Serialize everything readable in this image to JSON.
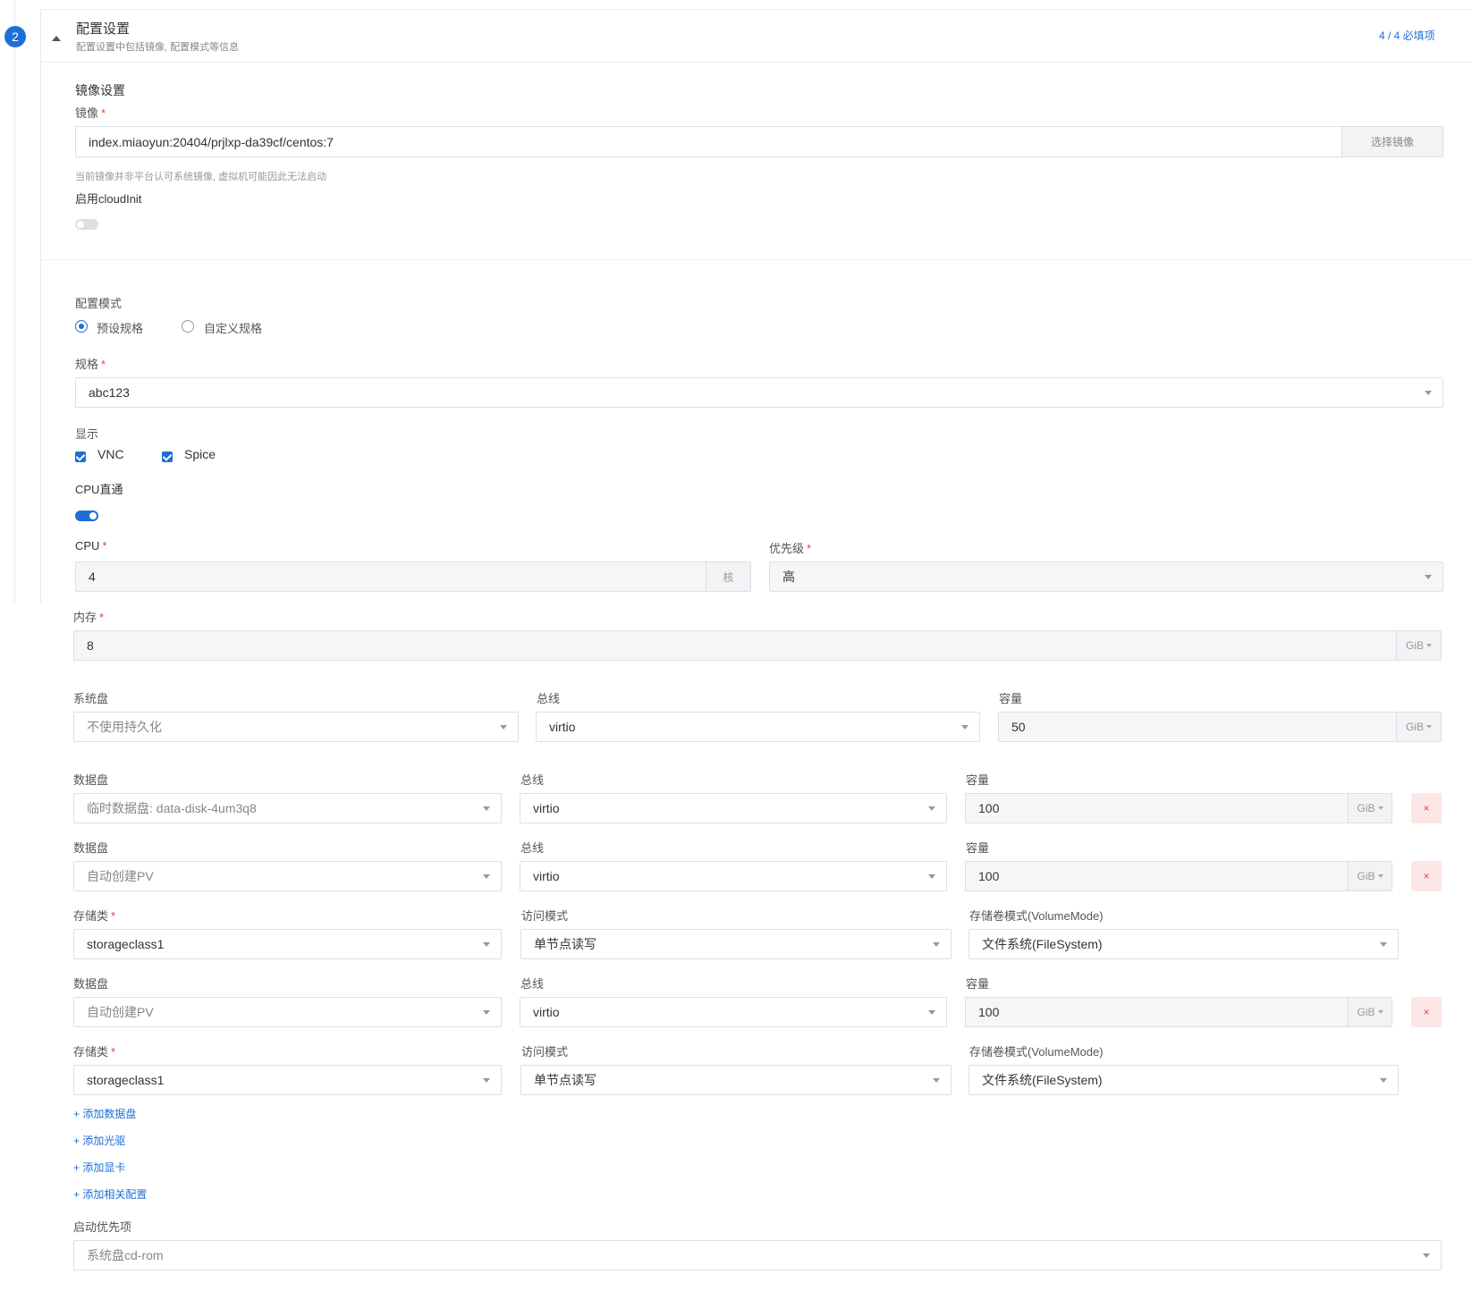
{
  "step": {
    "number": "2",
    "title": "配置设置",
    "subtitle": "配置设置中包括镜像, 配置模式等信息",
    "required_count": "4 / 4 必填项"
  },
  "image_section": {
    "heading": "镜像设置",
    "image_label": "镜像",
    "image_value": "index.miaoyun:20404/prjlxp-da39cf/centos:7",
    "select_image_button": "选择镜像",
    "warning": "当前镜像并非平台认可系统镜像, 虚拟机可能因此无法启动",
    "cloudinit_label": "启用cloudInit",
    "cloudinit_enabled": false
  },
  "config": {
    "mode_label": "配置模式",
    "mode_options": [
      "预设规格",
      "自定义规格"
    ],
    "mode_selected": "预设规格",
    "spec_label": "规格",
    "spec_value": "abc123",
    "display_label": "显示",
    "display_options": [
      "VNC",
      "Spice"
    ],
    "cpu_passthrough_label": "CPU直通",
    "cpu_passthrough_enabled": true,
    "cpu_label": "CPU",
    "cpu_value": "4",
    "cpu_unit": "核",
    "priority_label": "优先级",
    "priority_value": "高",
    "memory_label": "内存",
    "memory_value": "8",
    "unit_gib": "GiB"
  },
  "system_disk": {
    "label": "系统盘",
    "value": "不使用持久化",
    "bus_label": "总线",
    "bus_value": "virtio",
    "capacity_label": "容量",
    "capacity_value": "50"
  },
  "data_disks": [
    {
      "label": "数据盘",
      "value": "临时数据盘: data-disk-4um3q8",
      "bus_label": "总线",
      "bus_value": "virtio",
      "capacity_label": "容量",
      "capacity_value": "100",
      "delete": "×"
    },
    {
      "label": "数据盘",
      "value": "自动创建PV",
      "bus_label": "总线",
      "bus_value": "virtio",
      "capacity_label": "容量",
      "capacity_value": "100",
      "delete": "×",
      "storage_class_label": "存储类",
      "storage_class_value": "storageclass1",
      "access_mode_label": "访问模式",
      "access_mode_value": "单节点读写",
      "volume_mode_label": "存储卷模式(VolumeMode)",
      "volume_mode_value": "文件系统(FileSystem)"
    },
    {
      "label": "数据盘",
      "value": "自动创建PV",
      "bus_label": "总线",
      "bus_value": "virtio",
      "capacity_label": "容量",
      "capacity_value": "100",
      "delete": "×",
      "storage_class_label": "存储类",
      "storage_class_value": "storageclass1",
      "access_mode_label": "访问模式",
      "access_mode_value": "单节点读写",
      "volume_mode_label": "存储卷模式(VolumeMode)",
      "volume_mode_value": "文件系统(FileSystem)"
    }
  ],
  "add_links": [
    "+ 添加数据盘",
    "+ 添加光驱",
    "+ 添加显卡",
    "+ 添加相关配置"
  ],
  "boot": {
    "label": "启动优先项",
    "value": "系统盘cd-rom"
  },
  "colors": {
    "accent": "#1d6fd6",
    "required": "#e5443b",
    "danger_bg": "#fde6e6"
  }
}
